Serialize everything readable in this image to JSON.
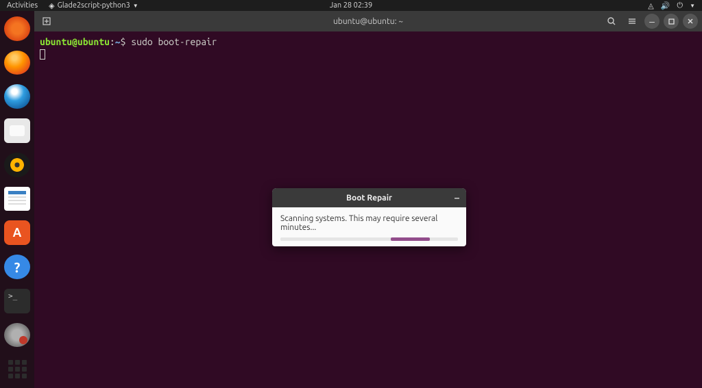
{
  "topbar": {
    "activities": "Activities",
    "app_name": "Glade2script-python3",
    "datetime": "Jan 28  02:39"
  },
  "dock": {
    "items": [
      {
        "name": "distributor-logo",
        "class": "distributor"
      },
      {
        "name": "firefox",
        "class": "firefox"
      },
      {
        "name": "thunderbird",
        "class": "thunderbird"
      },
      {
        "name": "files",
        "class": "files"
      },
      {
        "name": "rhythmbox",
        "class": "rhythmbox"
      },
      {
        "name": "libreoffice-writer",
        "class": "libreoffice"
      },
      {
        "name": "ubuntu-software",
        "class": "software"
      },
      {
        "name": "help",
        "class": "help"
      },
      {
        "name": "terminal",
        "class": "terminal-icon"
      },
      {
        "name": "boot-repair",
        "class": "bootrepair"
      }
    ]
  },
  "terminal": {
    "title": "ubuntu@ubuntu: ~",
    "prompt_user": "ubuntu@ubuntu",
    "prompt_colon": ":",
    "prompt_path": "~",
    "prompt_dollar": "$",
    "command": " sudo boot-repair"
  },
  "dialog": {
    "title": "Boot Repair",
    "message": "Scanning systems. This may require several minutes..."
  }
}
